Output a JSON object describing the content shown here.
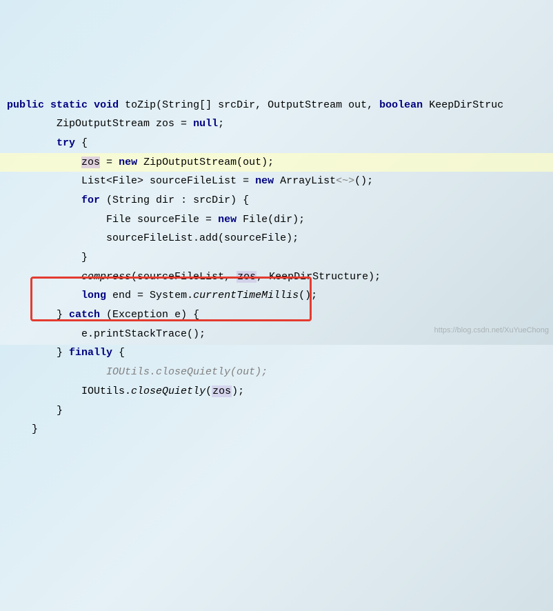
{
  "code": {
    "l1": {
      "kw1": "public",
      "kw2": "static",
      "kw3": "void",
      "name": "toZip",
      "p": "(String[] srcDir, OutputStream out, ",
      "kw4": "boolean",
      "p2": " KeepDirStruc"
    },
    "l2": {
      "a": "ZipOutputStream zos = ",
      "kw": "null",
      "b": ";"
    },
    "l3": {
      "kw": "try",
      "b": " {"
    },
    "l4": {
      "var": "zos",
      "a": " = ",
      "kw": "new",
      "b": " ZipOutputStream(out);"
    },
    "l5": {
      "a": "List<File> sourceFileList = ",
      "kw": "new",
      "b": " ArrayList",
      "g": "<~>",
      "c": "();"
    },
    "l6": {
      "kw": "for",
      "a": " (String dir : srcDir) {"
    },
    "l7": {
      "a": "File sourceFile = ",
      "kw": "new",
      "b": " File(dir);"
    },
    "l8": {
      "a": "sourceFileList.add(sourceFile);"
    },
    "l9": {
      "a": "}"
    },
    "l10": {
      "m": "compress",
      "a": "(sourceFileList, ",
      "var": "zos",
      "b": ", KeepDirStructure);"
    },
    "l11": {
      "kw": "long",
      "a": " end = System.",
      "m": "currentTimeMillis",
      "b": "();"
    },
    "l12": {
      "a": "} ",
      "kw": "catch",
      "b": " (Exception e) {"
    },
    "l13": {
      "a": "e.printStackTrace();"
    },
    "l14": {
      "a": "} ",
      "kw": "finally",
      "b": " {"
    },
    "l15": {
      "c": "IOUtils.closeQuietly(out);"
    },
    "l16": {
      "a": "IOUtils.",
      "m": "closeQuietly",
      "b": "(",
      "var": "zos",
      "c": ");"
    },
    "l17": {
      "a": "}"
    },
    "l18": {
      "a": "}"
    }
  },
  "indent": {
    "i1": "    ",
    "i2": "        ",
    "i3": "            ",
    "i4": "                "
  },
  "watermark": "https://blog.csdn.net/XuYueChong"
}
